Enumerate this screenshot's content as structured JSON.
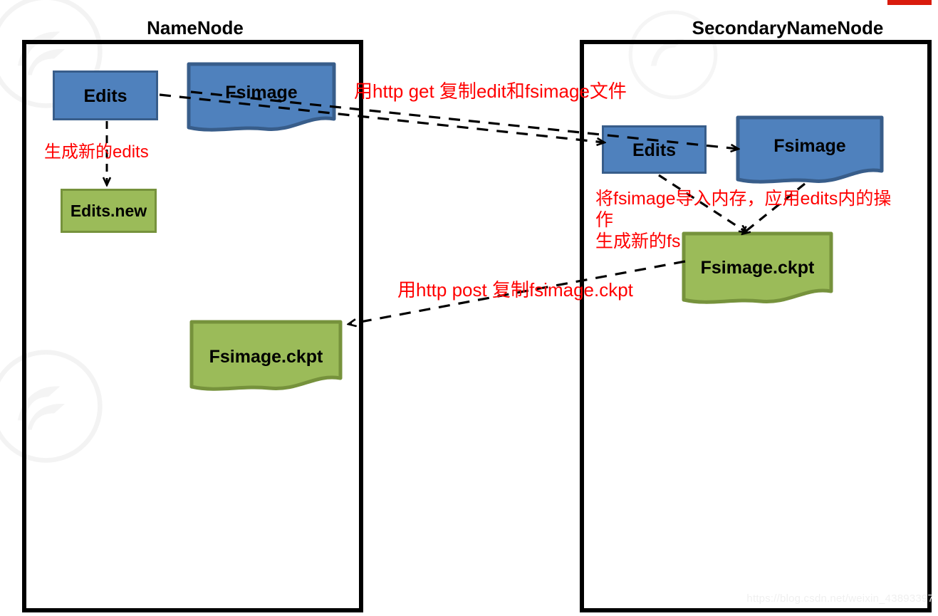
{
  "diagram": {
    "title_left": "NameNode",
    "title_right": "SecondaryNameNode",
    "watermark_url": "https://blog.csdn.net/weixin_43893397"
  },
  "colors": {
    "blue_fill": "#4F81BD",
    "blue_border": "#385D8A",
    "green_fill": "#9BBB59",
    "green_border": "#76923C",
    "annotation_red": "#FF0000",
    "panel_border": "#000000"
  },
  "namenode": {
    "nodes": [
      {
        "id": "nn-edits",
        "label": "Edits",
        "shape": "rectangle",
        "color": "blue"
      },
      {
        "id": "nn-fsimage",
        "label": "Fsimage",
        "shape": "document",
        "color": "blue"
      },
      {
        "id": "nn-edits-new",
        "label": "Edits.new",
        "shape": "rectangle",
        "color": "green"
      },
      {
        "id": "nn-fsimage-ckpt",
        "label": "Fsimage.ckpt",
        "shape": "document",
        "color": "green"
      }
    ],
    "annotations": [
      {
        "id": "note-new-edits",
        "text": "生成新的edits"
      }
    ]
  },
  "secondarynamenode": {
    "nodes": [
      {
        "id": "snn-edits",
        "label": "Edits",
        "shape": "rectangle",
        "color": "blue"
      },
      {
        "id": "snn-fsimage",
        "label": "Fsimage",
        "shape": "document",
        "color": "blue"
      },
      {
        "id": "snn-fsimage-ckpt",
        "label": "Fsimage.ckpt",
        "shape": "document",
        "color": "green"
      }
    ],
    "annotations": [
      {
        "id": "note-merge-line1",
        "text": "将fsimage导入内存，应用edits内的操"
      },
      {
        "id": "note-merge-line2",
        "text": "作"
      },
      {
        "id": "note-merge-line3",
        "text": "生成新的fs"
      }
    ]
  },
  "transfers": [
    {
      "id": "note-http-get",
      "text": "用http get 复制edit和fsimage文件"
    },
    {
      "id": "note-http-post",
      "text": "用http post 复制fsimage.ckpt"
    }
  ]
}
